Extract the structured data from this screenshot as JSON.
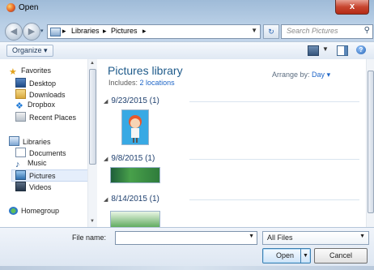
{
  "window": {
    "title": "Open",
    "close_glyph": "x"
  },
  "nav": {
    "back_glyph": "◀",
    "forward_glyph": "▶",
    "breadcrumb": [
      "Libraries",
      "Pictures"
    ],
    "separator": "▸",
    "search_placeholder": "Search Pictures"
  },
  "toolbar": {
    "organize_label": "Organize ▾"
  },
  "sidebar": {
    "favorites_label": "Favorites",
    "favorites": [
      "Desktop",
      "Downloads",
      "Dropbox",
      "Recent Places"
    ],
    "libraries_label": "Libraries",
    "libraries": [
      "Documents",
      "Music",
      "Pictures",
      "Videos"
    ],
    "homegroup_label": "Homegroup",
    "selected": "Pictures"
  },
  "content": {
    "title": "Pictures library",
    "includes_prefix": "Includes:",
    "includes_link": "2 locations",
    "arrange_label": "Arrange by:",
    "arrange_value": "Day",
    "groups": [
      "9/23/2015 (1)",
      "9/8/2015 (1)",
      "8/14/2015 (1)"
    ]
  },
  "footer": {
    "file_name_label": "File name:",
    "file_name_value": "",
    "file_type": "All Files",
    "open_label": "Open",
    "cancel_label": "Cancel"
  },
  "colors": {
    "accent": "#1e65c7",
    "title_blue": "#1e5a8a",
    "selection": "#e5eefb"
  },
  "icons": {
    "favorites": "star-icon",
    "desktop": "desktop-icon",
    "downloads": "downloads-folder-icon",
    "dropbox": "dropbox-icon",
    "recent": "recent-places-icon",
    "libraries": "libraries-icon",
    "homegroup": "homegroup-icon"
  }
}
